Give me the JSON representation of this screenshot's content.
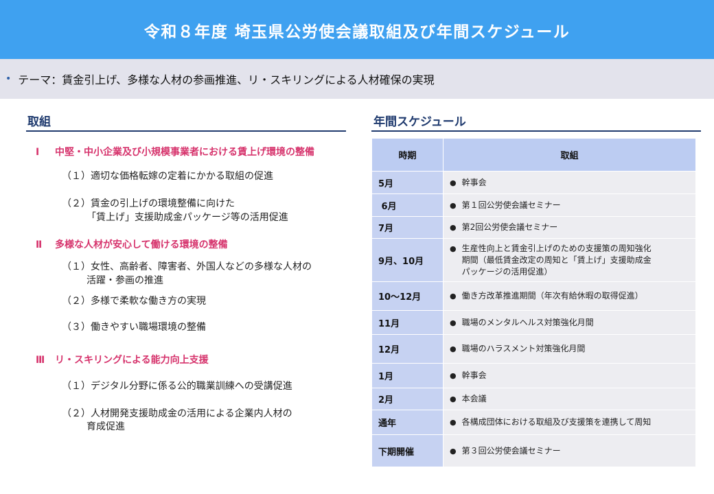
{
  "banner": {
    "title": "令和８年度 埼玉県公労使会議取組及び年間スケジュール"
  },
  "theme": {
    "bullet": "•",
    "text": "テーマ：賃金引上げ、多様な人材の参画推進、リ・スキリングによる人材確保の実現"
  },
  "left": {
    "title": "取組",
    "sections": [
      {
        "num": "Ⅰ",
        "label": "中堅・中小企業及び小規模事業者における賃上げ環境の整備",
        "items": [
          {
            "text": "（１）適切な価格転嫁の定着にかかる取組の促進"
          },
          {
            "text": "（２）賃金の引上げの環境整備に向けた",
            "text2": "「賃上げ」支援助成金パッケージ等の活用促進"
          }
        ]
      },
      {
        "num": "Ⅱ",
        "label": "多様な人材が安心して働ける環境の整備",
        "items": [
          {
            "text": "（１）女性、高齢者、障害者、外国人などの多様な人材の",
            "text2": "活躍・参画の推進"
          },
          {
            "text": "（２）多様で柔軟な働き方の実現"
          },
          {
            "text": "（３）働きやすい職場環境の整備"
          }
        ]
      },
      {
        "num": "Ⅲ",
        "label": "リ・スキリングによる能力向上支援",
        "items": [
          {
            "text": "（１）デジタル分野に係る公的職業訓練への受講促進"
          },
          {
            "text": "（２）人材開発支援助成金の活用による企業内人材の",
            "text2": "育成促進"
          }
        ]
      }
    ]
  },
  "schedule": {
    "title": "年間スケジュール",
    "col_period": "時期",
    "col_action": "取組",
    "bullet": "●",
    "rows": [
      {
        "period": "5月",
        "action": "幹事会"
      },
      {
        "period": " 6月",
        "action": "第１回公労使会議セミナー"
      },
      {
        "period": "7月",
        "action": "第2回公労使会議セミナー"
      },
      {
        "period": "9月、10月",
        "action": "生産性向上と賃金引上げのための支援策の周知強化",
        "action2": "期間（最低賃金改定の周知と「賃上げ」支援助成金",
        "action3": "パッケージの活用促進）"
      },
      {
        "period": "10～12月",
        "action": "働き方改革推進期間（年次有給休暇の取得促進）"
      },
      {
        "period": "11月",
        "action": "職場のメンタルヘルス対策強化月間"
      },
      {
        "period": "12月",
        "action": "職場のハラスメント対策強化月間"
      },
      {
        "period": "1月",
        "action": "幹事会"
      },
      {
        "period": "2月",
        "action": "本会議"
      },
      {
        "period": "通年",
        "action": "各構成団体における取組及び支援策を連携して周知"
      },
      {
        "period": "下期開催",
        "action": "第３回公労使会議セミナー"
      }
    ]
  }
}
